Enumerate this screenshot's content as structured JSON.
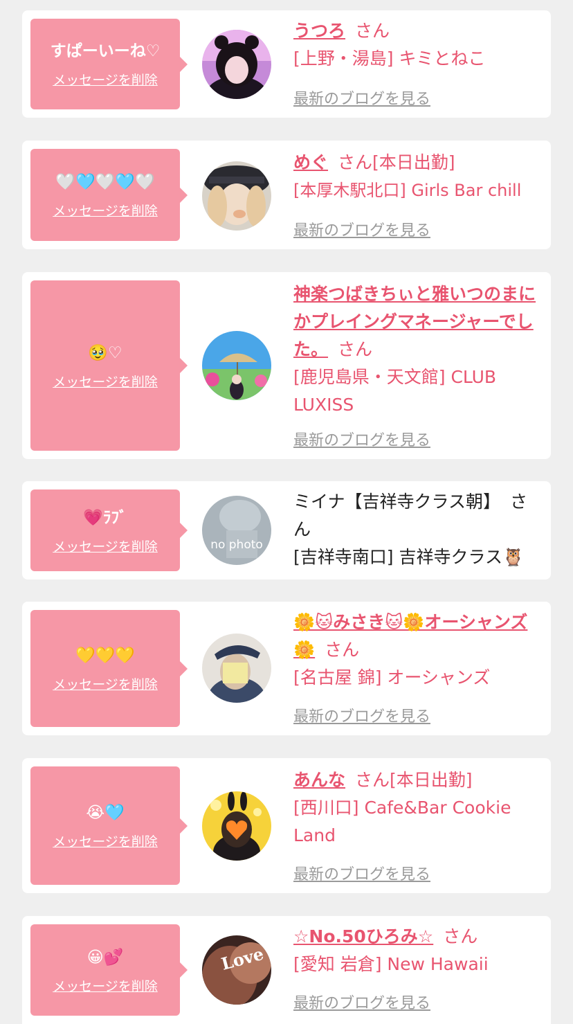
{
  "cards": [
    {
      "reaction": "すぱーいーね♡",
      "delete_label": "メッセージを削除",
      "name": "うつろ",
      "honorific": "さん",
      "status": "",
      "shop": "[上野・湯島] キミとねこ",
      "blog_link": "最新のブログを見る"
    },
    {
      "reaction": "🤍🩵🤍🩵🤍",
      "delete_label": "メッセージを削除",
      "name": "めぐ",
      "honorific": "さん",
      "status": "[本日出勤]",
      "shop": "[本厚木駅北口] Girls Bar chill",
      "blog_link": "最新のブログを見る"
    },
    {
      "reaction": "🥹♡",
      "delete_label": "メッセージを削除",
      "name": "神楽つばきちぃと雅いつのまにかプレイングマネージャーでした。",
      "honorific": "さん",
      "status": "",
      "shop": "[鹿児島県・天文館] CLUB LUXISS",
      "blog_link": "最新のブログを見る"
    },
    {
      "reaction": "💗ﾗﾌﾞ",
      "delete_label": "メッセージを削除",
      "name": "ミイナ【吉祥寺クラス朝】",
      "honorific": "さん",
      "status": "",
      "shop": "[吉祥寺南口] 吉祥寺クラス🦉",
      "blog_link": "",
      "avatar_text": "no photo"
    },
    {
      "reaction": "💛💛💛",
      "delete_label": "メッセージを削除",
      "name": "🌼🐱みさき🐱🌼オーシャンズ🌼",
      "honorific": "さん",
      "status": "",
      "shop": "[名古屋 錦] オーシャンズ",
      "blog_link": "最新のブログを見る"
    },
    {
      "reaction": "😭🩵",
      "delete_label": "メッセージを削除",
      "name": "あんな",
      "honorific": "さん",
      "status": "[本日出勤]",
      "shop": "[西川口] Cafe&Bar Cookie Land",
      "blog_link": "最新のブログを見る"
    },
    {
      "reaction": "😀💕",
      "delete_label": "メッセージを削除",
      "name": "☆No.50ひろみ☆",
      "honorific": "さん",
      "status": "",
      "shop": "[愛知 岩倉] New Hawaii",
      "blog_link": "最新のブログを見る",
      "avatar_text": "Love"
    }
  ],
  "colors": {
    "accent": "#e8546f",
    "bubble": "#f697a6",
    "page_bg": "#efefef",
    "link_gray": "#9a9a9a"
  }
}
